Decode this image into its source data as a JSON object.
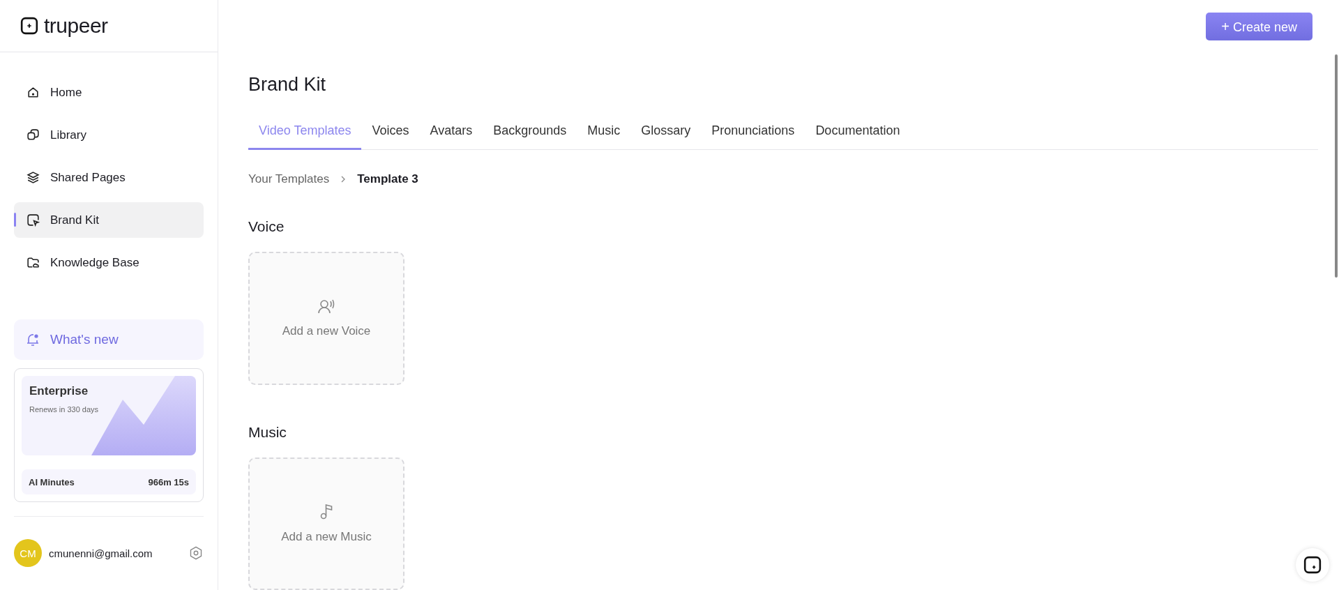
{
  "logo": {
    "text": "trupeer"
  },
  "nav": [
    {
      "label": "Home",
      "kind": "home",
      "selected": false
    },
    {
      "label": "Library",
      "kind": "library",
      "selected": false
    },
    {
      "label": "Shared Pages",
      "kind": "shared",
      "selected": false
    },
    {
      "label": "Brand Kit",
      "kind": "brand",
      "selected": true
    },
    {
      "label": "Knowledge Base",
      "kind": "knowledge",
      "selected": false
    }
  ],
  "whats_new": {
    "label": "What's new"
  },
  "plan": {
    "name": "Enterprise",
    "renewal": "Renews in 330 days",
    "usage_label": "AI Minutes",
    "usage_value": "966m 15s"
  },
  "user": {
    "initials": "CM",
    "email": "cmunenni@gmail.com"
  },
  "create_button": {
    "icon": "+",
    "label": "Create new"
  },
  "page_title": "Brand Kit",
  "tabs": [
    {
      "label": "Video Templates",
      "selected": true
    },
    {
      "label": "Voices",
      "selected": false
    },
    {
      "label": "Avatars",
      "selected": false
    },
    {
      "label": "Backgrounds",
      "selected": false
    },
    {
      "label": "Music",
      "selected": false
    },
    {
      "label": "Glossary",
      "selected": false
    },
    {
      "label": "Pronunciations",
      "selected": false
    },
    {
      "label": "Documentation",
      "selected": false
    }
  ],
  "breadcrumb": [
    {
      "label": "Your Templates",
      "selected": false
    },
    {
      "label": "Template 3",
      "selected": true
    }
  ],
  "sections": [
    {
      "title": "Voice",
      "kind": "voice",
      "add_label": "Add a new Voice"
    },
    {
      "title": "Music",
      "kind": "music",
      "add_label": "Add a new Music"
    }
  ]
}
